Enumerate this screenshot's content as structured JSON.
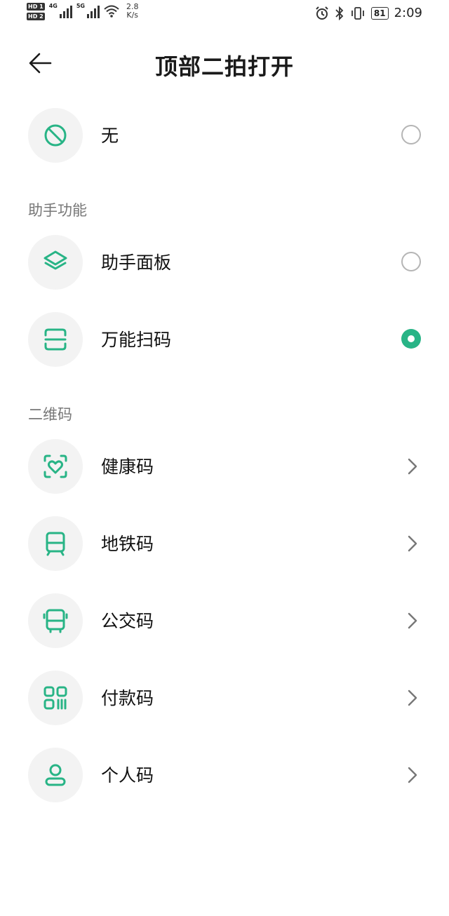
{
  "status_bar": {
    "sim1": "HD 1",
    "sim2": "HD 2",
    "net1": "4G",
    "net2": "5G",
    "speed_value": "2.8",
    "speed_unit": "K/s",
    "battery": "81",
    "time": "2:09"
  },
  "header": {
    "title": "顶部二拍打开"
  },
  "options": {
    "none": {
      "label": "无",
      "icon": "forbidden-icon",
      "selected": false
    }
  },
  "sections": {
    "assistant": {
      "title": "助手功能",
      "items": [
        {
          "label": "助手面板",
          "icon": "layers-icon",
          "selected": false
        },
        {
          "label": "万能扫码",
          "icon": "scan-icon",
          "selected": true
        }
      ]
    },
    "qrcode": {
      "title": "二维码",
      "items": [
        {
          "label": "健康码",
          "icon": "health-heart-icon"
        },
        {
          "label": "地铁码",
          "icon": "metro-icon"
        },
        {
          "label": "公交码",
          "icon": "bus-icon"
        },
        {
          "label": "付款码",
          "icon": "payment-code-icon"
        },
        {
          "label": "个人码",
          "icon": "person-icon"
        }
      ]
    }
  },
  "colors": {
    "accent": "#28b486",
    "icon_bg": "#f3f3f3",
    "section_text": "#777777"
  }
}
